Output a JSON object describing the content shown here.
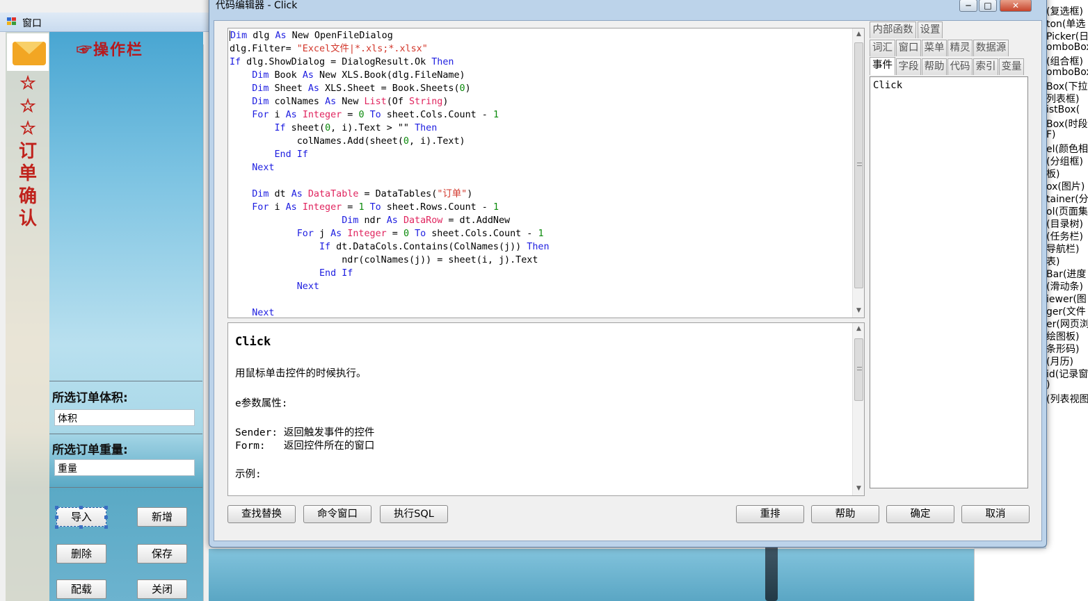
{
  "bg_window": {
    "title": "窗口",
    "ops_title": "☞操作栏",
    "vertical_title": [
      "☆",
      "☆",
      "☆",
      "订",
      "单",
      "确",
      "认"
    ],
    "volume_label": "所选订单体积:",
    "volume_value": "体积",
    "weight_label": "所选订单重量:",
    "weight_value": "重量",
    "buttons": {
      "import": "导入",
      "add": "新增",
      "delete": "删除",
      "save": "保存",
      "load": "配载",
      "close": "关闭"
    }
  },
  "toolbox_items": [
    "(复选框)",
    "ton(单选",
    "Picker(日",
    "omboBox(",
    "(组合框)",
    "omboBox(",
    "Box(下拉",
    "列表框)",
    "istBox(",
    "Box(时段",
    "F)",
    "el(颜色相",
    "(分组框)",
    "板)",
    "ox(图片)",
    "tainer(分",
    "ol(页面集",
    "(目录树)",
    "(任务栏)",
    "导航栏)",
    "表)",
    "Bar(进度",
    "(滑动条)",
    "iewer(图",
    "ger(文件",
    "er(网页浏",
    "绘图板)",
    "条形码)",
    "(月历)",
    "id(记录窗",
    ")",
    "(列表视图"
  ],
  "editor": {
    "title": "代码编辑器 - Click",
    "window_buttons": {
      "min": "─",
      "max": "□",
      "close": "✕"
    },
    "code_lines": [
      [
        {
          "k": "kw",
          "t": "Dim"
        },
        {
          "t": " dlg "
        },
        {
          "k": "kw",
          "t": "As"
        },
        {
          "t": " New OpenFileDialog"
        }
      ],
      [
        {
          "t": "dlg.Filter= "
        },
        {
          "k": "str",
          "t": "\"Excel文件|*.xls;*.xlsx\""
        }
      ],
      [
        {
          "k": "kw",
          "t": "If"
        },
        {
          "t": " dlg.ShowDialog = DialogResult.Ok "
        },
        {
          "k": "kw",
          "t": "Then"
        }
      ],
      [
        {
          "t": "    "
        },
        {
          "k": "kw",
          "t": "Dim"
        },
        {
          "t": " Book "
        },
        {
          "k": "kw",
          "t": "As"
        },
        {
          "t": " New XLS.Book(dlg.FileName)"
        }
      ],
      [
        {
          "t": "    "
        },
        {
          "k": "kw",
          "t": "Dim"
        },
        {
          "t": " Sheet "
        },
        {
          "k": "kw",
          "t": "As"
        },
        {
          "t": " XLS.Sheet = Book.Sheets("
        },
        {
          "k": "num",
          "t": "0"
        },
        {
          "t": ")"
        }
      ],
      [
        {
          "t": "    "
        },
        {
          "k": "kw",
          "t": "Dim"
        },
        {
          "t": " colNames "
        },
        {
          "k": "kw",
          "t": "As"
        },
        {
          "t": " New "
        },
        {
          "k": "ty",
          "t": "List"
        },
        {
          "t": "(Of "
        },
        {
          "k": "ty",
          "t": "String"
        },
        {
          "t": ")"
        }
      ],
      [
        {
          "t": "    "
        },
        {
          "k": "kw",
          "t": "For"
        },
        {
          "t": " i "
        },
        {
          "k": "kw",
          "t": "As"
        },
        {
          "t": " "
        },
        {
          "k": "ty",
          "t": "Integer"
        },
        {
          "t": " = "
        },
        {
          "k": "num",
          "t": "0"
        },
        {
          "t": " "
        },
        {
          "k": "kw",
          "t": "To"
        },
        {
          "t": " sheet.Cols.Count - "
        },
        {
          "k": "num",
          "t": "1"
        }
      ],
      [
        {
          "t": "        "
        },
        {
          "k": "kw",
          "t": "If"
        },
        {
          "t": " sheet("
        },
        {
          "k": "num",
          "t": "0"
        },
        {
          "t": ", i).Text > \"\" "
        },
        {
          "k": "kw",
          "t": "Then"
        }
      ],
      [
        {
          "t": "            colNames.Add(sheet("
        },
        {
          "k": "num",
          "t": "0"
        },
        {
          "t": ", i).Text)"
        }
      ],
      [
        {
          "t": "        "
        },
        {
          "k": "kw",
          "t": "End If"
        }
      ],
      [
        {
          "t": "    "
        },
        {
          "k": "kw",
          "t": "Next"
        }
      ],
      [
        {
          "t": ""
        }
      ],
      [
        {
          "t": "    "
        },
        {
          "k": "kw",
          "t": "Dim"
        },
        {
          "t": " dt "
        },
        {
          "k": "kw",
          "t": "As"
        },
        {
          "t": " "
        },
        {
          "k": "ty",
          "t": "DataTable"
        },
        {
          "t": " = DataTables("
        },
        {
          "k": "str",
          "t": "\"订单\""
        },
        {
          "t": ")"
        }
      ],
      [
        {
          "t": "    "
        },
        {
          "k": "kw",
          "t": "For"
        },
        {
          "t": " i "
        },
        {
          "k": "kw",
          "t": "As"
        },
        {
          "t": " "
        },
        {
          "k": "ty",
          "t": "Integer"
        },
        {
          "t": " = "
        },
        {
          "k": "num",
          "t": "1"
        },
        {
          "t": " "
        },
        {
          "k": "kw",
          "t": "To"
        },
        {
          "t": " sheet.Rows.Count - "
        },
        {
          "k": "num",
          "t": "1"
        }
      ],
      [
        {
          "t": "                    "
        },
        {
          "k": "kw",
          "t": "Dim"
        },
        {
          "t": " ndr "
        },
        {
          "k": "kw",
          "t": "As"
        },
        {
          "t": " "
        },
        {
          "k": "ty",
          "t": "DataRow"
        },
        {
          "t": " = dt.AddNew"
        }
      ],
      [
        {
          "t": "            "
        },
        {
          "k": "kw",
          "t": "For"
        },
        {
          "t": " j "
        },
        {
          "k": "kw",
          "t": "As"
        },
        {
          "t": " "
        },
        {
          "k": "ty",
          "t": "Integer"
        },
        {
          "t": " = "
        },
        {
          "k": "num",
          "t": "0"
        },
        {
          "t": " "
        },
        {
          "k": "kw",
          "t": "To"
        },
        {
          "t": " sheet.Cols.Count - "
        },
        {
          "k": "num",
          "t": "1"
        }
      ],
      [
        {
          "t": "                "
        },
        {
          "k": "kw",
          "t": "If"
        },
        {
          "t": " dt.DataCols.Contains(ColNames(j)) "
        },
        {
          "k": "kw",
          "t": "Then"
        }
      ],
      [
        {
          "t": "                    ndr(colNames(j)) = sheet(i, j).Text"
        }
      ],
      [
        {
          "t": "                "
        },
        {
          "k": "kw",
          "t": "End If"
        }
      ],
      [
        {
          "t": "            "
        },
        {
          "k": "kw",
          "t": "Next"
        }
      ],
      [
        {
          "t": ""
        }
      ],
      [
        {
          "t": "    "
        },
        {
          "k": "kw",
          "t": "Next"
        }
      ]
    ],
    "help": {
      "title": "Click",
      "lines": [
        "用鼠标单击控件的时候执行。",
        "e参数属性:",
        "Sender: 返回触发事件的控件",
        "Form:   返回控件所在的窗口",
        "示例:"
      ]
    },
    "tabs_row1": [
      "内部函数",
      "设置"
    ],
    "tabs_row2": [
      "词汇",
      "窗口",
      "菜单",
      "精灵",
      "数据源"
    ],
    "tabs_row3": [
      "事件",
      "字段",
      "帮助",
      "代码",
      "索引",
      "变量"
    ],
    "event_selected": "Click",
    "buttons": {
      "find_replace": "查找替换",
      "command_window": "命令窗口",
      "exec_sql": "执行SQL",
      "reformat": "重排",
      "help": "帮助",
      "ok": "确定",
      "cancel": "取消"
    }
  }
}
